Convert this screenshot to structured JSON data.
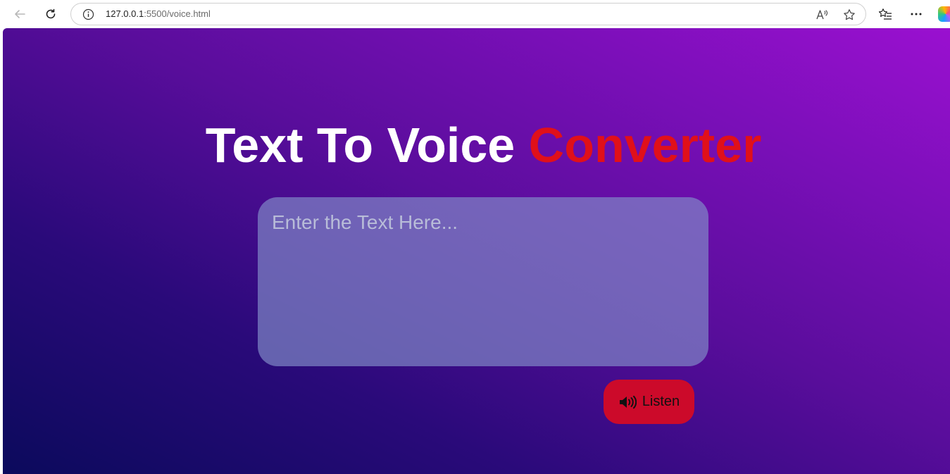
{
  "browser": {
    "url_host": "127.0.0.1",
    "url_rest": ":5500/voice.html"
  },
  "page": {
    "title_main": "Text To Voice ",
    "title_accent": "Converter",
    "input_placeholder": "Enter the Text Here...",
    "listen_label": "Listen"
  },
  "colors": {
    "title_accent": "#e0101a",
    "button": "#cc0a2a",
    "gradient_start": "#0b0a5c",
    "gradient_end": "#9a10d0"
  },
  "icons": {
    "back": "back-arrow-icon",
    "reload": "reload-icon",
    "info": "info-icon",
    "read_aloud": "read-aloud-icon",
    "favorite": "star-icon",
    "favorites_list": "favorites-icon",
    "more": "more-icon",
    "copilot": "copilot-icon",
    "speaker": "speaker-icon"
  }
}
